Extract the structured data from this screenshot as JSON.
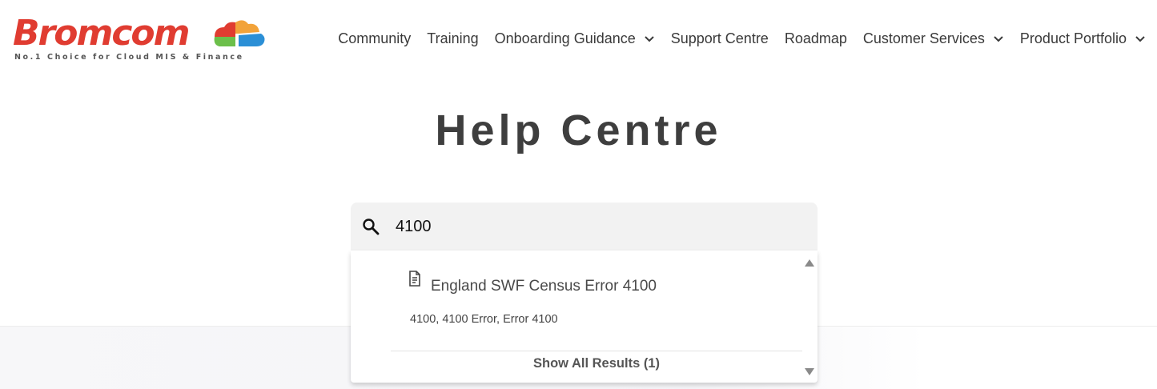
{
  "logo": {
    "wordmark": "Bromcom",
    "tagline": "No.1 Choice for Cloud MIS & Finance",
    "colors": {
      "red": "#e03c31",
      "orange": "#f2a33a",
      "green": "#6cbf4a",
      "blue": "#2b8fd6"
    }
  },
  "nav": {
    "items": [
      {
        "label": "Community",
        "icon": null
      },
      {
        "label": "Training",
        "icon": null
      },
      {
        "label": "Onboarding Guidance",
        "icon": "chevron-down-icon"
      },
      {
        "label": "Support Centre",
        "icon": null
      },
      {
        "label": "Roadmap",
        "icon": null
      },
      {
        "label": "Customer Services",
        "icon": "chevron-down-icon"
      },
      {
        "label": "Product Portfolio",
        "icon": "chevron-down-icon"
      }
    ]
  },
  "page": {
    "title": "Help Centre"
  },
  "search": {
    "icon": "search-icon",
    "value": "4100",
    "placeholder": ""
  },
  "results": {
    "items": [
      {
        "icon": "document-icon",
        "title": "England SWF Census Error 4100",
        "tags": "4100, 4100 Error, Error 4100"
      }
    ],
    "show_all_label": "Show All Results (1)"
  }
}
